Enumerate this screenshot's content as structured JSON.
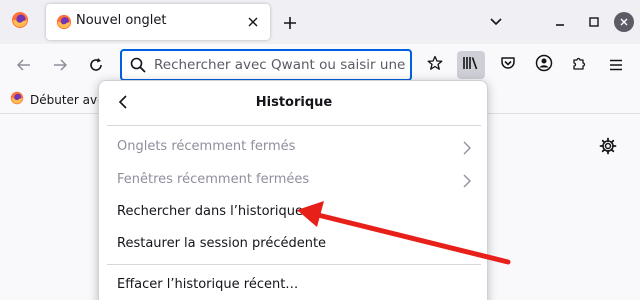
{
  "tabs": [
    {
      "title": "Nouvel onglet"
    }
  ],
  "nav": {
    "search_placeholder": "Rechercher avec Qwant ou saisir une adresse"
  },
  "bookmarks": [
    {
      "label": "Débuter avec Firefox"
    }
  ],
  "panel": {
    "title": "Historique",
    "items": [
      {
        "label": "Onglets récemment fermés",
        "disabled": true,
        "submenu": true
      },
      {
        "label": "Fenêtres récemment fermées",
        "disabled": true,
        "submenu": true
      },
      {
        "label": "Rechercher dans l’historique",
        "disabled": false
      },
      {
        "label": "Restaurer la session précédente",
        "disabled": false
      },
      {
        "label": "Effacer l’historique récent…",
        "disabled": false
      }
    ]
  },
  "colors": {
    "annotation_arrow": "#e8201a",
    "focus_ring": "#0061e0",
    "firefox_orange": "#ff7139"
  }
}
